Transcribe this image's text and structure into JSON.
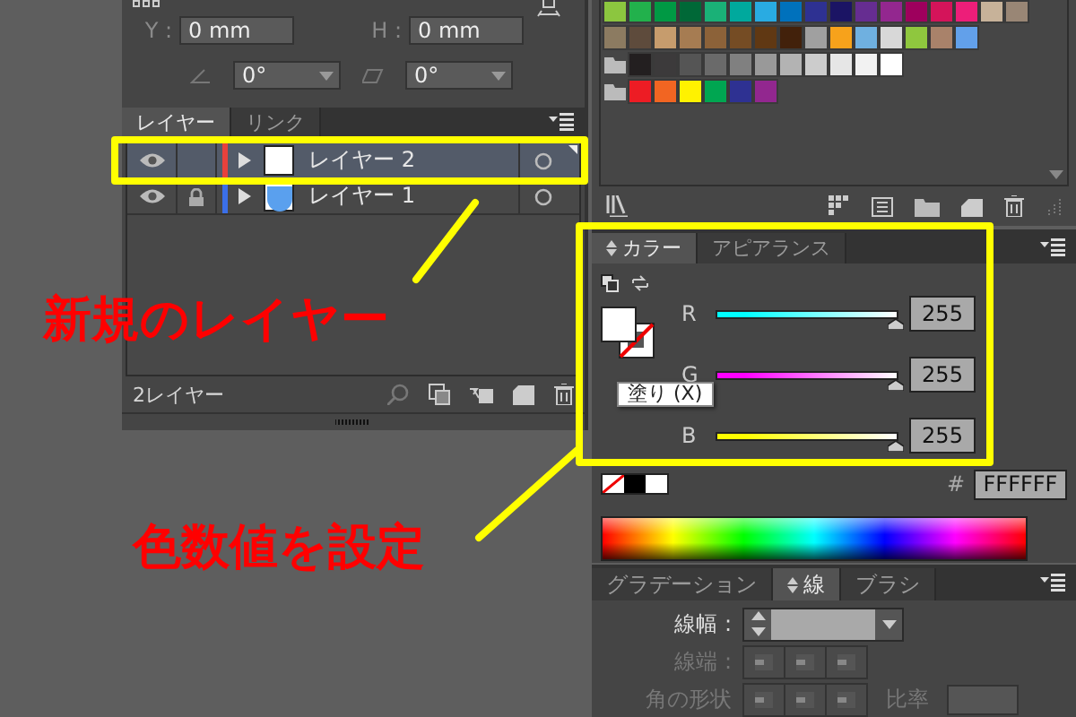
{
  "transform": {
    "fields": [
      {
        "label": "Y :",
        "value": "0 mm"
      },
      {
        "label": "H :",
        "value": "0 mm"
      }
    ],
    "angles": [
      {
        "value": "0°"
      },
      {
        "value": "0°"
      }
    ]
  },
  "layers_panel": {
    "tabs": [
      {
        "label": "レイヤー",
        "selected": true
      },
      {
        "label": "リンク",
        "selected": false
      }
    ],
    "layers": [
      {
        "name": "レイヤー 2",
        "selected": true,
        "locked": false,
        "color": "#e8413c",
        "kind": "blank"
      },
      {
        "name": "レイヤー 1",
        "selected": false,
        "locked": true,
        "color": "#3b6fe8",
        "kind": "shape"
      }
    ],
    "count": "2レイヤー"
  },
  "swatches": {
    "rows": [
      {
        "folder": false,
        "swatches": [
          {
            "color": "#8cc63f"
          },
          {
            "color": "#22b14c"
          },
          {
            "color": "#009944"
          },
          {
            "color": "#006837"
          },
          {
            "color": "#1ab177"
          },
          {
            "color": "#00a99d"
          },
          {
            "color": "#29abe2"
          },
          {
            "color": "#0071bc"
          },
          {
            "color": "#2e3192"
          },
          {
            "color": "#1b1464"
          },
          {
            "color": "#662d91"
          },
          {
            "color": "#93278f"
          },
          {
            "color": "#9e005d"
          },
          {
            "color": "#d4145a"
          },
          {
            "color": "#ed1e79"
          },
          {
            "color": "#c7b299"
          },
          {
            "color": "#998675"
          }
        ]
      },
      {
        "folder": false,
        "swatches": [
          {
            "color": "#8c7b61"
          },
          {
            "color": "#5e4b3c"
          },
          {
            "color": "#c69c6d"
          },
          {
            "color": "#a67c52"
          },
          {
            "color": "#8c6239"
          },
          {
            "color": "#754c24"
          },
          {
            "color": "#603813"
          },
          {
            "color": "#42210b"
          },
          {
            "color": "#a0a0a0"
          },
          {
            "color": "#f7a21b"
          },
          {
            "color": "#6fb0e0"
          },
          {
            "color": "#d8d8d8"
          },
          {
            "color": "#8fc73e"
          },
          {
            "color": "#a9826a"
          },
          {
            "color": "#62a0ea"
          }
        ]
      },
      {
        "folder": true,
        "swatches": [
          {
            "color": "#231f20"
          },
          {
            "color": "#3c3a3b"
          },
          {
            "color": "#555555"
          },
          {
            "color": "#6a6a6a"
          },
          {
            "color": "#808080"
          },
          {
            "color": "#999999"
          },
          {
            "color": "#b3b3b3"
          },
          {
            "color": "#cccccc"
          },
          {
            "color": "#e6e6e6"
          },
          {
            "color": "#f2f2f2"
          },
          {
            "color": "#ffffff"
          }
        ]
      },
      {
        "folder": true,
        "swatches": [
          {
            "color": "#ed1c24"
          },
          {
            "color": "#f26522"
          },
          {
            "color": "#fff200"
          },
          {
            "color": "#00a651"
          },
          {
            "color": "#2e3192"
          },
          {
            "color": "#92278f"
          }
        ]
      }
    ]
  },
  "color_panel": {
    "tabs": [
      {
        "label": "カラー",
        "selected": true
      },
      {
        "label": "アピアランス",
        "selected": false
      }
    ],
    "sliders": [
      {
        "channel": "R",
        "color": "#00ffff",
        "level": 1,
        "value": "255"
      },
      {
        "channel": "G",
        "color": "#ff00ff",
        "level": 1,
        "value": "255"
      },
      {
        "channel": "B",
        "color": "#ffff00",
        "level": 1,
        "value": "255"
      }
    ],
    "tooltip": "塗り (X)",
    "hex_label": "#",
    "hex": "FFFFFF"
  },
  "stroke_panel": {
    "tabs": [
      {
        "label": "グラデーション",
        "selected": false
      },
      {
        "label": "線",
        "selected": true
      },
      {
        "label": "ブラシ",
        "selected": false
      }
    ],
    "rows": [
      {
        "kind": "width",
        "label": "線幅 :",
        "disabled": false
      },
      {
        "kind": "caps",
        "label": "線端 :",
        "disabled": true
      },
      {
        "kind": "corner",
        "label": "角の形状",
        "disabled": true,
        "extra_label": "比率"
      }
    ]
  },
  "annotations": [
    {
      "text": "新規のレイヤー"
    },
    {
      "text": "色数値を設定"
    }
  ]
}
